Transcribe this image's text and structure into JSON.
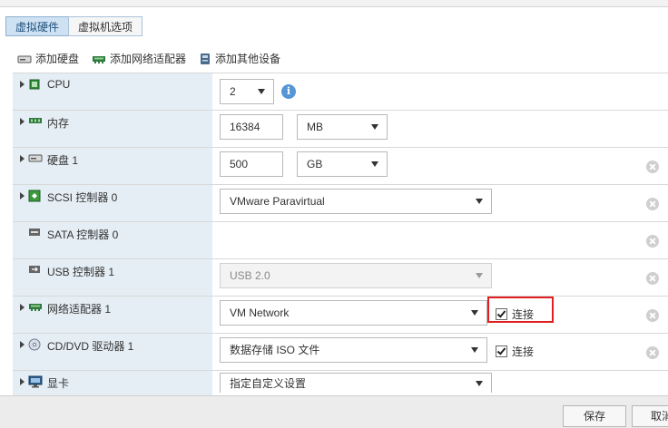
{
  "tabs": [
    {
      "label": "虚拟硬件",
      "active": true
    },
    {
      "label": "虚拟机选项",
      "active": false
    }
  ],
  "toolbar": {
    "add_disk": "添加硬盘",
    "add_nic": "添加网络适配器",
    "add_other": "添加其他设备"
  },
  "rows": {
    "cpu": {
      "label": "CPU",
      "value": "2"
    },
    "memory": {
      "label": "内存",
      "value": "16384",
      "unit": "MB"
    },
    "disk": {
      "label": "硬盘 1",
      "value": "500",
      "unit": "GB"
    },
    "scsi": {
      "label": "SCSI 控制器 0",
      "value": "VMware Paravirtual"
    },
    "sata": {
      "label": "SATA 控制器 0"
    },
    "usb": {
      "label": "USB 控制器 1",
      "value": "USB 2.0"
    },
    "nic": {
      "label": "网络适配器 1",
      "value": "VM Network",
      "connect_label": "连接",
      "connected": true
    },
    "cdrom": {
      "label": "CD/DVD 驱动器 1",
      "value": "数据存储 ISO 文件",
      "connect_label": "连接",
      "connected": true
    },
    "video": {
      "label": "显卡",
      "value": "指定自定义设置"
    }
  },
  "footer": {
    "save": "保存",
    "cancel": "取消"
  },
  "colors": {
    "highlight": "#e02020",
    "tab_active": "#cfe2f3",
    "label_cell": "#e5eef5"
  }
}
